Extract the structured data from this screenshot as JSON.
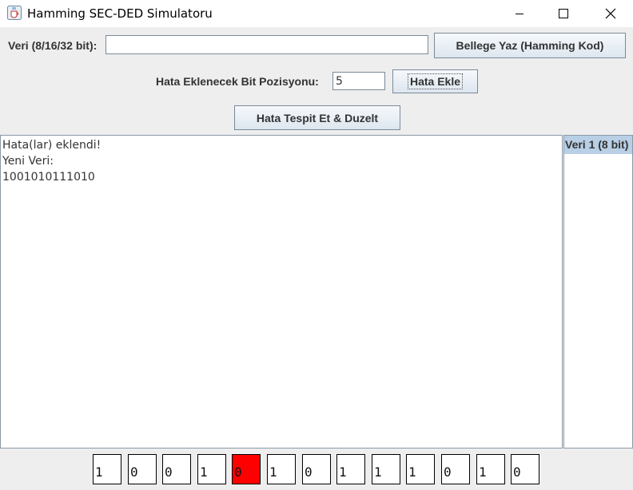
{
  "window": {
    "title": "Hamming SEC-DED Simulatoru",
    "icon": "java-cup-icon"
  },
  "input": {
    "veri_label": "Veri (8/16/32 bit):",
    "veri_value": ""
  },
  "buttons": {
    "write_label": "Bellege Yaz (Hamming Kod)",
    "inject_label": "Hata Ekle",
    "detect_label": "Hata Tespit Et & Duzelt"
  },
  "error_position": {
    "label": "Hata Eklenecek Bit Pozisyonu:",
    "value": "5"
  },
  "output": {
    "lines": [
      "Hata(lar) eklendi!",
      "Yeni Veri:",
      "1001010111010"
    ]
  },
  "memory_list": {
    "items": [
      "Veri 1 (8 bit)"
    ]
  },
  "bits": {
    "values": [
      "1",
      "0",
      "0",
      "1",
      "0",
      "1",
      "0",
      "1",
      "1",
      "1",
      "0",
      "1",
      "0"
    ],
    "error_index": 4,
    "error_color": "#ff0000"
  }
}
